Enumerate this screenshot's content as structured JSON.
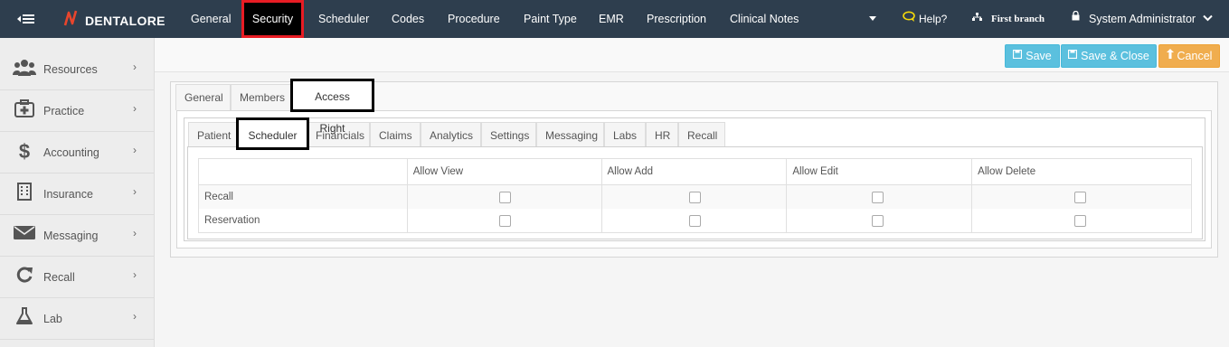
{
  "brand": {
    "name": "DENTALORE",
    "accent": "#e8452c"
  },
  "topnav": {
    "items": [
      "General",
      "Security",
      "Scheduler",
      "Codes",
      "Procedure",
      "Paint Type",
      "EMR",
      "Prescription",
      "Clinical Notes"
    ],
    "active": "Security",
    "help_label": "Help?",
    "branch_label": "First branch",
    "user_label": "System Administrator"
  },
  "sidebar": {
    "items": [
      {
        "label": "Resources",
        "icon": "users-icon"
      },
      {
        "label": "Practice",
        "icon": "medkit-icon"
      },
      {
        "label": "Accounting",
        "icon": "dollar-icon"
      },
      {
        "label": "Insurance",
        "icon": "building-icon"
      },
      {
        "label": "Messaging",
        "icon": "envelope-icon"
      },
      {
        "label": "Recall",
        "icon": "refresh-icon"
      },
      {
        "label": "Lab",
        "icon": "flask-icon"
      }
    ]
  },
  "toolbar": {
    "save_label": "Save",
    "save_close_label": "Save & Close",
    "cancel_label": "Cancel"
  },
  "outer_tabs": {
    "items": [
      "General",
      "Members",
      "Access Right"
    ],
    "active": "Access Right"
  },
  "inner_tabs": {
    "items": [
      "Patient",
      "Scheduler",
      "Financials",
      "Claims",
      "Analytics",
      "Settings",
      "Messaging",
      "Labs",
      "HR",
      "Recall"
    ],
    "active": "Scheduler"
  },
  "permissions": {
    "columns": [
      "",
      "Allow View",
      "Allow Add",
      "Allow Edit",
      "Allow Delete"
    ],
    "rows": [
      {
        "name": "Recall",
        "view": false,
        "add": false,
        "edit": false,
        "delete": false
      },
      {
        "name": "Reservation",
        "view": false,
        "add": false,
        "edit": false,
        "delete": false
      }
    ]
  },
  "colors": {
    "topbar": "#2e3e4e",
    "info_button": "#5bc0de",
    "warning_button": "#f0ad4e",
    "active_highlight": "#e81c24"
  }
}
